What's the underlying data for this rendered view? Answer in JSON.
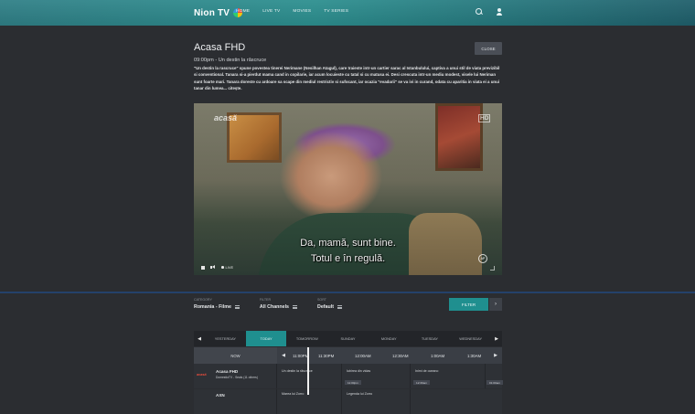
{
  "app": {
    "name": "Nion TV"
  },
  "nav": {
    "items": [
      "HOME",
      "LIVE TV",
      "MOVIES",
      "TV SERIES"
    ]
  },
  "program": {
    "title": "Acasa FHD",
    "time": "09:00pm - Un destin la răscruce",
    "description": "\"Un destin la rascruce\" spune povestea tinerei Nerimane (Nesilhan Atagul), care traieste intr-un cartier sarac al Istanbulului, captiva a unui stil de viata previzibil si conventional. Tanara si-a pierdut mama cand in copilarie, iar acum locuieste cu tatal si cu matusa ei. Desi crescuta intr-un mediu modest, visele lui Neriman sunt foarte mari. Tanara doreste cu ardoare sa scape din mediul restrictiv si sufocant, iar ocazia \"evadarii\" se va ivi in curand, odata cu aparitia in viata ei a unui tanar din lumea... citește.",
    "close_label": "CLOSE"
  },
  "player": {
    "channel_logo": "acasă",
    "quality_badge": "HD",
    "subtitle_line1": "Da, mamă, sunt bine.",
    "subtitle_line2": "Totul e în regulă.",
    "live_label": "LIVE",
    "ap_badge": "AP"
  },
  "filters": {
    "category": {
      "label": "CATEGORY",
      "value": "Romania - Filme"
    },
    "filter": {
      "label": "FILTER",
      "value": "All Channels"
    },
    "sort": {
      "label": "SORT",
      "value": "Default"
    },
    "button_label": "FILTER",
    "more_label": "›"
  },
  "epg": {
    "days": [
      "YESTERDAY",
      "TODAY",
      "TOMORROW",
      "SUNDAY",
      "MONDAY",
      "TUESDAY",
      "WEDNESDAY"
    ],
    "active_day": "TODAY",
    "now_label": "NOW",
    "time_slots": [
      "11:00PM",
      "11:30PM",
      "12:00AM",
      "12:30AM",
      "1:00AM",
      "1:30AM"
    ],
    "channels": [
      {
        "logo": "acasă",
        "name": "Acasa FHD",
        "subtitle": "DomestioTV - Seals (11 others)",
        "programs": [
          {
            "title": "Un destin la răscruce",
            "tag": ""
          },
          {
            "title": "Iubirea din vidas",
            "tag": "11:00pm"
          },
          {
            "title": "Inimi de oceano",
            "tag": "12:30am"
          },
          {
            "title": "",
            "tag": "01:00am"
          }
        ]
      },
      {
        "logo": "",
        "name": "AXN",
        "subtitle": "",
        "programs": [
          {
            "title": "Marea lui Zorro",
            "tag": ""
          },
          {
            "title": "Legenda lui Zorro",
            "tag": ""
          }
        ]
      }
    ]
  }
}
